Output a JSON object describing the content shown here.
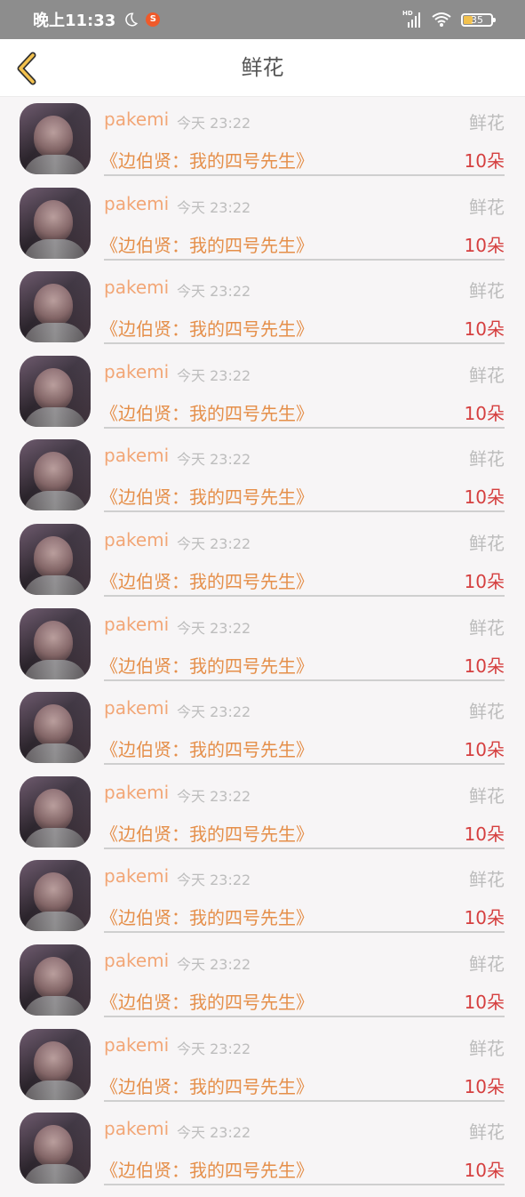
{
  "status_bar": {
    "time": "晚上11:33",
    "battery_percent": "35",
    "network_label": "HD"
  },
  "header": {
    "title": "鲜花"
  },
  "items": [
    {
      "user": "pakemi",
      "time": "今天 23:22",
      "type": "鲜花",
      "book": "《边伯贤：我的四号先生》",
      "quantity": "10朵"
    },
    {
      "user": "pakemi",
      "time": "今天 23:22",
      "type": "鲜花",
      "book": "《边伯贤：我的四号先生》",
      "quantity": "10朵"
    },
    {
      "user": "pakemi",
      "time": "今天 23:22",
      "type": "鲜花",
      "book": "《边伯贤：我的四号先生》",
      "quantity": "10朵"
    },
    {
      "user": "pakemi",
      "time": "今天 23:22",
      "type": "鲜花",
      "book": "《边伯贤：我的四号先生》",
      "quantity": "10朵"
    },
    {
      "user": "pakemi",
      "time": "今天 23:22",
      "type": "鲜花",
      "book": "《边伯贤：我的四号先生》",
      "quantity": "10朵"
    },
    {
      "user": "pakemi",
      "time": "今天 23:22",
      "type": "鲜花",
      "book": "《边伯贤：我的四号先生》",
      "quantity": "10朵"
    },
    {
      "user": "pakemi",
      "time": "今天 23:22",
      "type": "鲜花",
      "book": "《边伯贤：我的四号先生》",
      "quantity": "10朵"
    },
    {
      "user": "pakemi",
      "time": "今天 23:22",
      "type": "鲜花",
      "book": "《边伯贤：我的四号先生》",
      "quantity": "10朵"
    },
    {
      "user": "pakemi",
      "time": "今天 23:22",
      "type": "鲜花",
      "book": "《边伯贤：我的四号先生》",
      "quantity": "10朵"
    },
    {
      "user": "pakemi",
      "time": "今天 23:22",
      "type": "鲜花",
      "book": "《边伯贤：我的四号先生》",
      "quantity": "10朵"
    },
    {
      "user": "pakemi",
      "time": "今天 23:22",
      "type": "鲜花",
      "book": "《边伯贤：我的四号先生》",
      "quantity": "10朵"
    },
    {
      "user": "pakemi",
      "time": "今天 23:22",
      "type": "鲜花",
      "book": "《边伯贤：我的四号先生》",
      "quantity": "10朵"
    },
    {
      "user": "pakemi",
      "time": "今天 23:22",
      "type": "鲜花",
      "book": "《边伯贤：我的四号先生》",
      "quantity": "10朵"
    }
  ],
  "colors": {
    "status_bar_bg": "#8d8d8d",
    "username": "#f2a676",
    "book_title": "#e58f4a",
    "quantity": "#d53f3f",
    "muted": "#bcbcbc",
    "back_icon": "#f2c14e"
  }
}
